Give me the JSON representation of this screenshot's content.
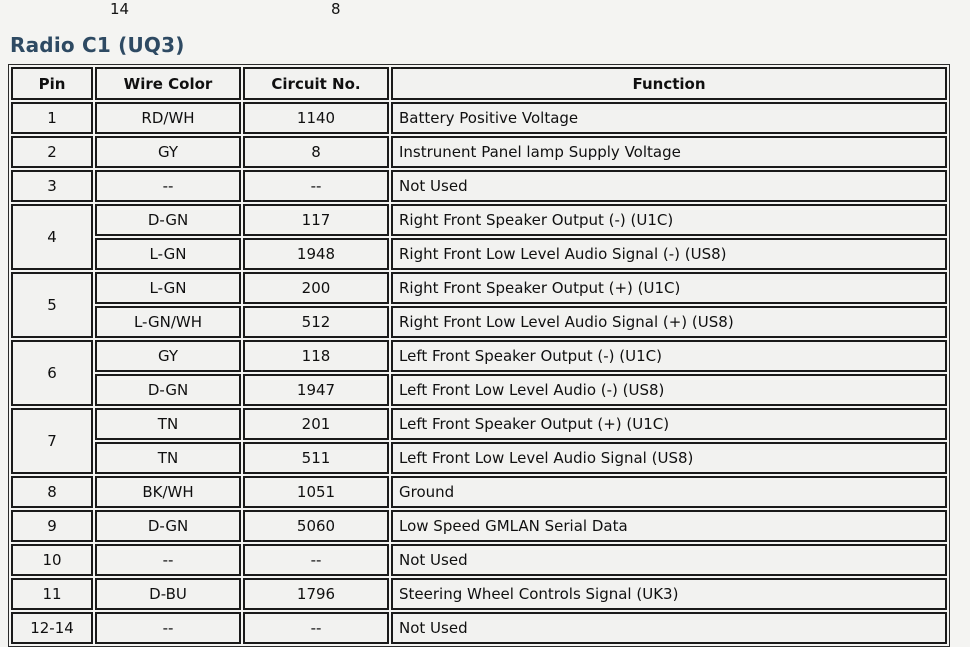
{
  "diagram_remnant": {
    "labels": [
      {
        "text": "14"
      },
      {
        "text": "8"
      }
    ]
  },
  "section": {
    "title": "Radio C1 (UQ3)",
    "title_color": "#2e4a63"
  },
  "table": {
    "columns": [
      {
        "key": "pin",
        "label": "Pin"
      },
      {
        "key": "wire",
        "label": "Wire Color"
      },
      {
        "key": "circuit",
        "label": "Circuit No."
      },
      {
        "key": "function",
        "label": "Function"
      }
    ],
    "rows": [
      {
        "pin": "1",
        "lines": [
          {
            "wire": "RD/WH",
            "circuit": "1140",
            "function": "Battery Positive Voltage"
          }
        ]
      },
      {
        "pin": "2",
        "lines": [
          {
            "wire": "GY",
            "circuit": "8",
            "function": "Instrunent Panel lamp Supply Voltage"
          }
        ]
      },
      {
        "pin": "3",
        "lines": [
          {
            "wire": "--",
            "circuit": "--",
            "function": "Not Used"
          }
        ]
      },
      {
        "pin": "4",
        "lines": [
          {
            "wire": "D-GN",
            "circuit": "117",
            "function": "Right Front Speaker Output (-) (U1C)"
          },
          {
            "wire": "L-GN",
            "circuit": "1948",
            "function": "Right Front Low Level Audio Signal (-) (US8)"
          }
        ]
      },
      {
        "pin": "5",
        "lines": [
          {
            "wire": "L-GN",
            "circuit": "200",
            "function": "Right Front Speaker Output (+) (U1C)"
          },
          {
            "wire": "L-GN/WH",
            "circuit": "512",
            "function": "Right Front Low Level Audio Signal (+) (US8)"
          }
        ]
      },
      {
        "pin": "6",
        "lines": [
          {
            "wire": "GY",
            "circuit": "118",
            "function": "Left Front Speaker Output (-) (U1C)"
          },
          {
            "wire": "D-GN",
            "circuit": "1947",
            "function": "Left Front Low Level Audio (-) (US8)"
          }
        ]
      },
      {
        "pin": "7",
        "lines": [
          {
            "wire": "TN",
            "circuit": "201",
            "function": "Left Front Speaker Output (+) (U1C)"
          },
          {
            "wire": "TN",
            "circuit": "511",
            "function": "Left Front Low Level Audio Signal (US8)"
          }
        ]
      },
      {
        "pin": "8",
        "lines": [
          {
            "wire": "BK/WH",
            "circuit": "1051",
            "function": "Ground"
          }
        ]
      },
      {
        "pin": "9",
        "lines": [
          {
            "wire": "D-GN",
            "circuit": "5060",
            "function": "Low Speed GMLAN Serial Data"
          }
        ]
      },
      {
        "pin": "10",
        "lines": [
          {
            "wire": "--",
            "circuit": "--",
            "function": "Not Used"
          }
        ]
      },
      {
        "pin": "11",
        "lines": [
          {
            "wire": "D-BU",
            "circuit": "1796",
            "function": "Steering Wheel Controls Signal (UK3)"
          }
        ]
      },
      {
        "pin": "12-14",
        "lines": [
          {
            "wire": "--",
            "circuit": "--",
            "function": "Not Used"
          }
        ]
      }
    ]
  }
}
